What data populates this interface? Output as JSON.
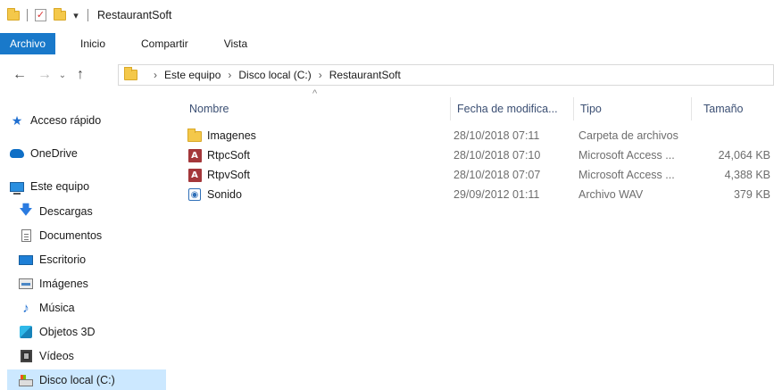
{
  "window": {
    "title": "RestaurantSoft",
    "qa_dropdown": "▾"
  },
  "ribbon": {
    "tabs": [
      {
        "label": "Archivo"
      },
      {
        "label": "Inicio"
      },
      {
        "label": "Compartir"
      },
      {
        "label": "Vista"
      }
    ],
    "accent": "#1979ca"
  },
  "nav": {
    "back": "←",
    "forward": "→",
    "recent": "⌄",
    "up": "↑",
    "breadcrumb": [
      "Este equipo",
      "Disco local (C:)",
      "RestaurantSoft"
    ],
    "separator": "›"
  },
  "sidebar": {
    "items": [
      {
        "label": "Acceso rápido",
        "icon": "star-icon"
      },
      {
        "label": "OneDrive",
        "icon": "cloud-icon"
      },
      {
        "label": "Este equipo",
        "icon": "computer-icon"
      },
      {
        "label": "Descargas",
        "icon": "download-icon"
      },
      {
        "label": "Documentos",
        "icon": "document-icon"
      },
      {
        "label": "Escritorio",
        "icon": "desktop-icon"
      },
      {
        "label": "Imágenes",
        "icon": "pictures-icon"
      },
      {
        "label": "Música",
        "icon": "music-icon"
      },
      {
        "label": "Objetos 3D",
        "icon": "objects-3d-icon"
      },
      {
        "label": "Vídeos",
        "icon": "videos-icon"
      },
      {
        "label": "Disco local (C:)",
        "icon": "drive-icon",
        "selected": true
      }
    ],
    "selected_color": "#cce8ff"
  },
  "filelist": {
    "sort_indicator": "^",
    "columns": {
      "name": "Nombre",
      "date": "Fecha de modifica...",
      "type": "Tipo",
      "size": "Tamaño"
    },
    "rows": [
      {
        "name": "Imagenes",
        "date": "28/10/2018 07:11",
        "type": "Carpeta de archivos",
        "size": "",
        "icon": "folder-icon"
      },
      {
        "name": "RtpcSoft",
        "date": "28/10/2018 07:10",
        "type": "Microsoft Access ...",
        "size": "24,064 KB",
        "icon": "access-db-icon"
      },
      {
        "name": "RtpvSoft",
        "date": "28/10/2018 07:07",
        "type": "Microsoft Access ...",
        "size": "4,388 KB",
        "icon": "access-db-icon"
      },
      {
        "name": "Sonido",
        "date": "29/09/2012 01:11",
        "type": "Archivo WAV",
        "size": "379 KB",
        "icon": "audio-file-icon"
      }
    ]
  }
}
